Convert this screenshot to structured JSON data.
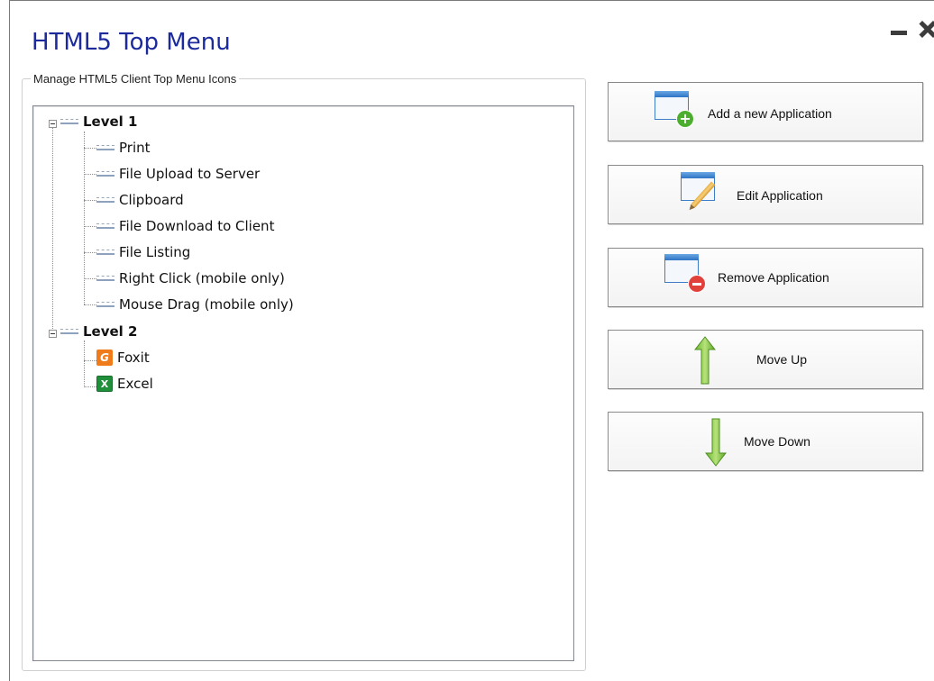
{
  "window": {
    "title": "HTML5 Top Menu",
    "controls": {
      "minimize_icon": "minimize-icon",
      "close_icon": "close-icon"
    }
  },
  "group": {
    "legend": "Manage HTML5 Client Top Menu Icons"
  },
  "tree": {
    "levels": [
      {
        "label": "Level 1",
        "icon": "menu-node-icon",
        "expanded": true,
        "children": [
          {
            "label": "Print",
            "icon": "menu-node-icon"
          },
          {
            "label": "File Upload to Server",
            "icon": "menu-node-icon"
          },
          {
            "label": "Clipboard",
            "icon": "menu-node-icon"
          },
          {
            "label": "File Download to Client",
            "icon": "menu-node-icon"
          },
          {
            "label": "File Listing",
            "icon": "menu-node-icon"
          },
          {
            "label": "Right Click (mobile only)",
            "icon": "menu-node-icon"
          },
          {
            "label": "Mouse Drag (mobile only)",
            "icon": "menu-node-icon"
          }
        ]
      },
      {
        "label": "Level 2",
        "icon": "menu-node-icon",
        "expanded": true,
        "children": [
          {
            "label": "Foxit",
            "icon": "foxit-icon",
            "glyph": "G"
          },
          {
            "label": "Excel",
            "icon": "excel-icon",
            "glyph": "X"
          }
        ]
      }
    ]
  },
  "actions": {
    "add": {
      "label": "Add a new Application",
      "icon": "add-application-icon"
    },
    "edit": {
      "label": "Edit Application",
      "icon": "edit-application-icon"
    },
    "remove": {
      "label": "Remove Application",
      "icon": "remove-application-icon"
    },
    "move_up": {
      "label": "Move Up",
      "icon": "arrow-up-icon"
    },
    "move_down": {
      "label": "Move Down",
      "icon": "arrow-down-icon"
    }
  },
  "colors": {
    "title": "#1c2a9c",
    "arrow_green": "#7ac943",
    "add_badge": "#4cae2f",
    "remove_badge": "#e0423b",
    "window_icon_blue": "#3f7dc6"
  }
}
